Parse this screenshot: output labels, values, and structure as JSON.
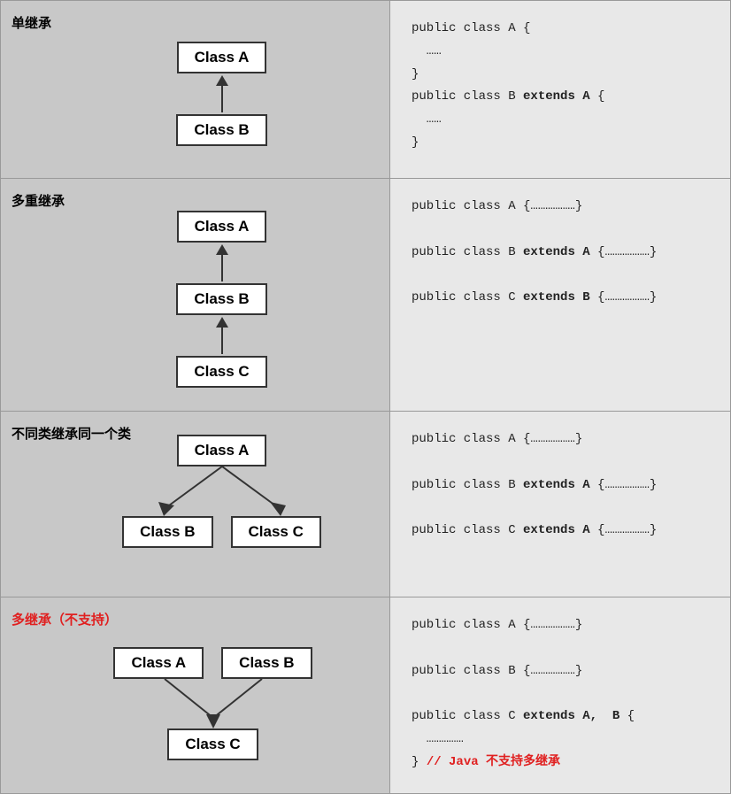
{
  "sections": [
    {
      "id": "single-inheritance",
      "label": "单继承",
      "label_color": "black",
      "diagram_type": "single",
      "classes": [
        "Class A",
        "Class B"
      ],
      "code_lines": [
        {
          "text": "public class A {",
          "bold_parts": []
        },
        {
          "text": "  ……",
          "bold_parts": []
        },
        {
          "text": "}",
          "bold_parts": []
        },
        {
          "text": "public class B extends A {",
          "bold_parts": [
            "extends A"
          ]
        },
        {
          "text": "  ……",
          "bold_parts": []
        },
        {
          "text": "}",
          "bold_parts": []
        }
      ]
    },
    {
      "id": "multi-level-inheritance",
      "label": "多重继承",
      "label_color": "black",
      "diagram_type": "chain",
      "classes": [
        "Class A",
        "Class B",
        "Class C"
      ],
      "code_lines": [
        {
          "text": "public class A {………………}",
          "bold_parts": []
        },
        {
          "text": "",
          "bold_parts": []
        },
        {
          "text": "public class B extends A {………………}",
          "bold_parts": [
            "extends A"
          ]
        },
        {
          "text": "",
          "bold_parts": []
        },
        {
          "text": "public class C extends B {………………}",
          "bold_parts": [
            "extends B"
          ]
        }
      ]
    },
    {
      "id": "different-classes-same-parent",
      "label": "不同类继承同一个类",
      "label_color": "black",
      "diagram_type": "fan-out",
      "classes": [
        "Class A",
        "Class B",
        "Class C"
      ],
      "code_lines": [
        {
          "text": "public class A {………………}",
          "bold_parts": []
        },
        {
          "text": "",
          "bold_parts": []
        },
        {
          "text": "public class B extends A {………………}",
          "bold_parts": [
            "extends A"
          ]
        },
        {
          "text": "",
          "bold_parts": []
        },
        {
          "text": "public class C extends A {………………}",
          "bold_parts": [
            "extends A"
          ]
        }
      ]
    },
    {
      "id": "multiple-inheritance-unsupported",
      "label": "多继承（不支持）",
      "label_color": "red",
      "diagram_type": "fan-in",
      "classes": [
        "Class A",
        "Class B",
        "Class C"
      ],
      "code_lines": [
        {
          "text": "public class A {………………}",
          "bold_parts": []
        },
        {
          "text": "",
          "bold_parts": []
        },
        {
          "text": "public class B {………………}",
          "bold_parts": []
        },
        {
          "text": "",
          "bold_parts": []
        },
        {
          "text": "public class C extends A,  B {",
          "bold_parts": [
            "extends A,  B"
          ]
        },
        {
          "text": "  ……………",
          "bold_parts": []
        },
        {
          "text": "} // Java 不支持多继承",
          "bold_parts": [
            "// Java 不支持多继承"
          ],
          "is_red_suffix": true
        }
      ]
    }
  ]
}
